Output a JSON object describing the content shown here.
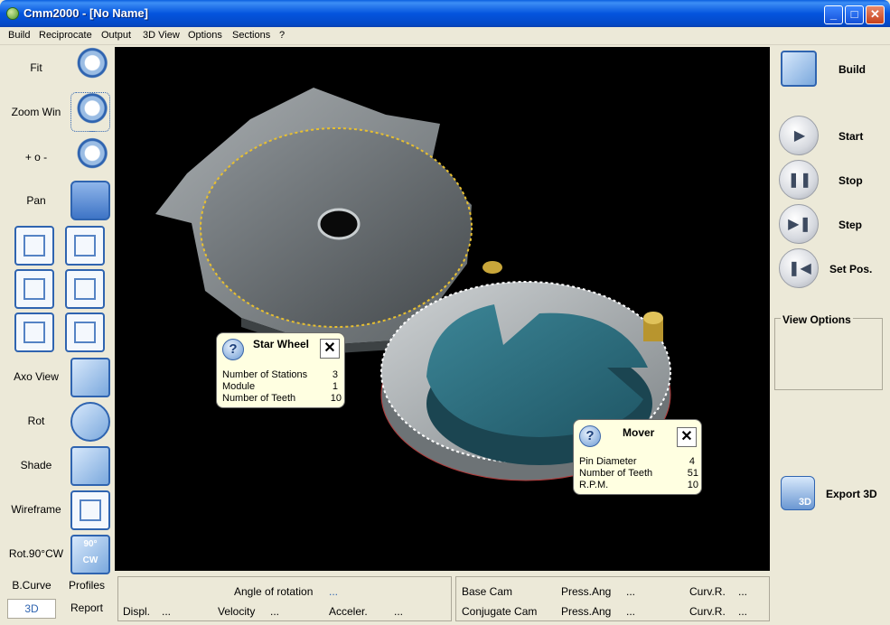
{
  "window": {
    "title": "Cmm2000 - [No Name]"
  },
  "menu": [
    "Build",
    "Reciprocate",
    "Output",
    "3D View",
    "Options",
    "Sections",
    "?"
  ],
  "left_toolbar": {
    "fit": "Fit",
    "zoom_win": "Zoom Win",
    "zoom_pm": "+ o -",
    "pan": "Pan",
    "axo_view": "Axo View",
    "rot": "Rot",
    "shade": "Shade",
    "wireframe": "Wireframe",
    "rot90": "Rot.90°CW",
    "rot90_badge_top": "90°",
    "rot90_badge_bottom": "CW"
  },
  "bottom_tabs": {
    "bcurve": "B.Curve",
    "profiles": "Profiles",
    "tab_3d": "3D",
    "report": "Report"
  },
  "star_wheel": {
    "title": "Star Wheel",
    "rows": [
      {
        "label": "Number of Stations",
        "value": "3"
      },
      {
        "label": "Module",
        "value": "1"
      },
      {
        "label": "Number of Teeth",
        "value": "10"
      }
    ]
  },
  "mover": {
    "title": "Mover",
    "rows": [
      {
        "label": "Pin Diameter",
        "value": "4"
      },
      {
        "label": "Number of Teeth",
        "value": "51"
      },
      {
        "label": "R.P.M.",
        "value": "10"
      }
    ]
  },
  "motion_panel": {
    "angle_label": "Angle of rotation",
    "angle_value": "...",
    "displ_label": "Displ.",
    "displ_value": "...",
    "velocity_label": "Velocity",
    "velocity_value": "...",
    "acceler_label": "Acceler.",
    "acceler_value": "..."
  },
  "cam_panel": {
    "base_cam": "Base Cam",
    "conj_cam": "Conjugate Cam",
    "press_ang": "Press.Ang",
    "curv_r": "Curv.R.",
    "v1": "...",
    "v2": "...",
    "v3": "...",
    "v4": "..."
  },
  "right_panel": {
    "build": "Build",
    "start": "Start",
    "stop": "Stop",
    "step": "Step",
    "set_pos": "Set Pos.",
    "view_options": "View Options",
    "export_3d": "Export 3D",
    "export_badge": "3D"
  },
  "colors": {
    "title_blue": "#0455de",
    "viewport_bg": "#000000",
    "callout_bg": "#ffffe1",
    "cam_teal": "#2c6877"
  }
}
